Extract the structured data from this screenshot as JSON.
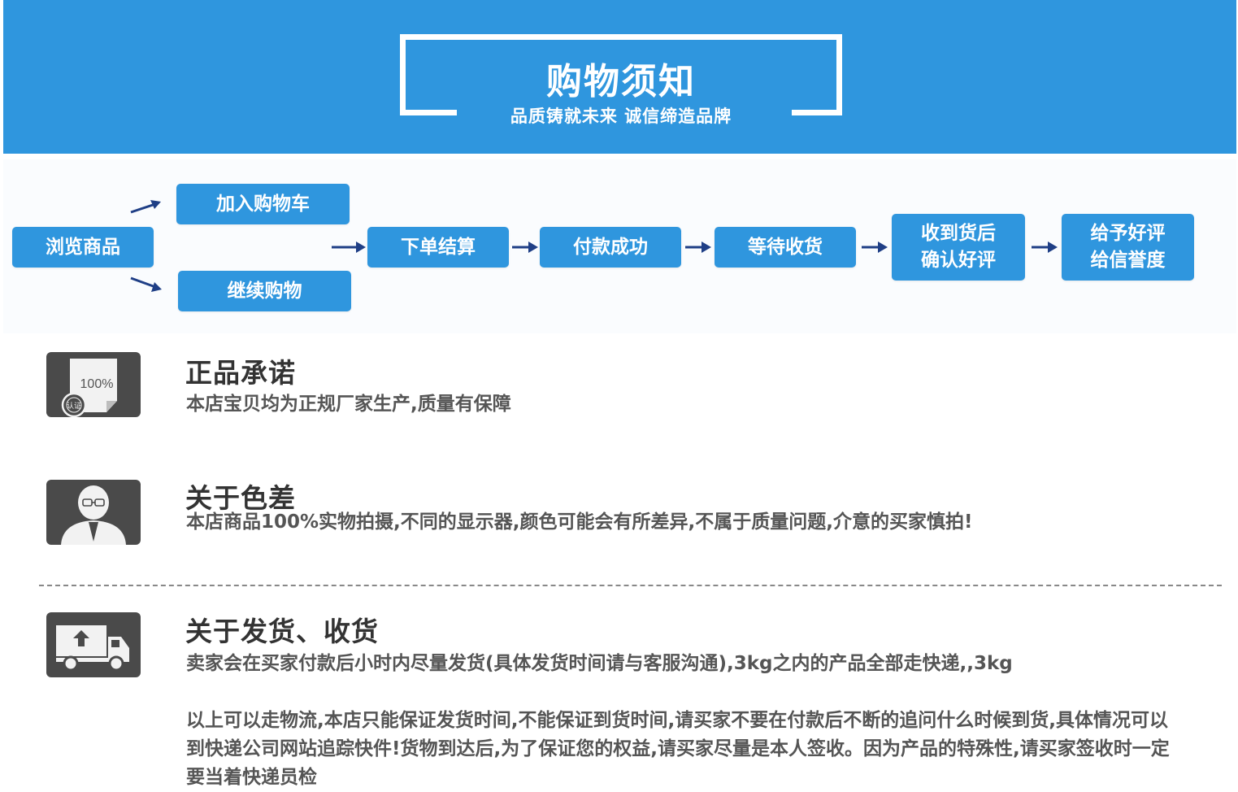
{
  "header": {
    "title": "购物须知",
    "subtitle": "品质铸就未来 诚信缔造品牌",
    "bg_color": "#2f96de"
  },
  "flow": {
    "browse": "浏览商品",
    "add_cart": "加入购物车",
    "continue": "继续购物",
    "checkout": "下单结算",
    "paid": "付款成功",
    "waiting": "等待收货",
    "received": "收到货后\n确认好评",
    "review": "给予好评\n给信誉度",
    "accent": "#2f96de",
    "arrow_color": "#1f3f86"
  },
  "sections": {
    "genuine": {
      "title": "正品承诺",
      "text": "本店宝贝均为正规厂家生产,质量有保障",
      "badge_percent": "100%",
      "badge_label": "认证",
      "icon": "certificate-icon"
    },
    "color": {
      "title": "关于色差",
      "text": "本店商品100%实物拍摄,不同的显示器,颜色可能会有所差异,不属于质量问题,介意的买家慎拍!",
      "icon": "person-icon"
    },
    "shipping": {
      "title": "关于发货、收货",
      "text1": "卖家会在买家付款后小时内尽量发货(具体发货时间请与客服沟通),3kg之内的产品全部走快递,,3kg",
      "text2": "以上可以走物流,本店只能保证发货时间,不能保证到货时间,请买家不要在付款后不断的追问什么时候到货,具体情况可以到快递公司网站追踪快件!货物到达后,为了保证您的权益,请买家尽量是本人签收。因为产品的特殊性,请买家签收时一定要当着快递员检",
      "icon": "truck-icon"
    }
  }
}
